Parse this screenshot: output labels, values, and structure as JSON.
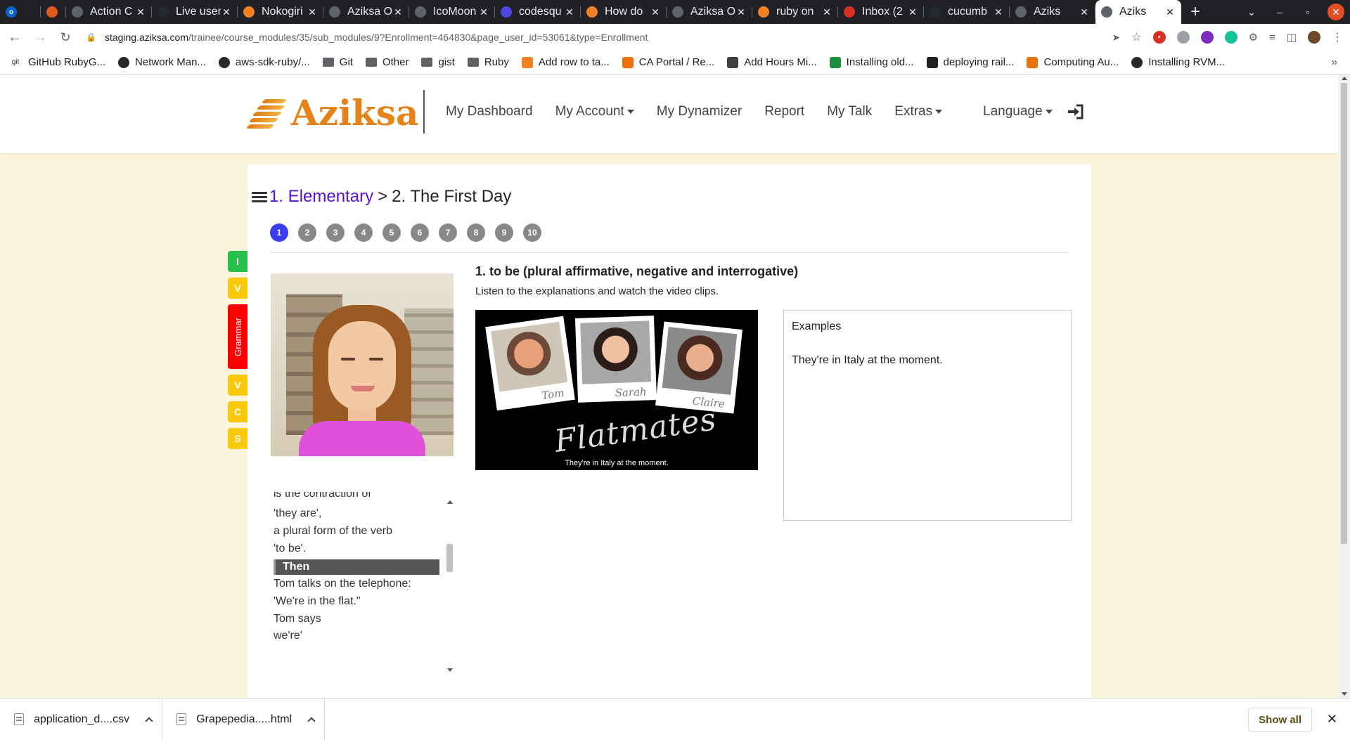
{
  "browser": {
    "tabs": [
      {
        "title": "",
        "favicon_color": "#0a64c8",
        "favicon_glyph": "o"
      },
      {
        "title": "",
        "favicon_color": "#e05a1c",
        "favicon_glyph": ""
      },
      {
        "title": "Action C",
        "favicon_color": "#5f6368",
        "favicon_glyph": ""
      },
      {
        "title": "Live user",
        "favicon_color": "#24292e",
        "favicon_glyph": ""
      },
      {
        "title": "Nokogiri",
        "favicon_color": "#f48024",
        "favicon_glyph": ""
      },
      {
        "title": "Aziksa O",
        "favicon_color": "#5f6368",
        "favicon_glyph": ""
      },
      {
        "title": "IcoMoon",
        "favicon_color": "#5f6368",
        "favicon_glyph": ""
      },
      {
        "title": "codesqu",
        "favicon_color": "#4f46e5",
        "favicon_glyph": ""
      },
      {
        "title": "How do",
        "favicon_color": "#f48024",
        "favicon_glyph": ""
      },
      {
        "title": "Aziksa O",
        "favicon_color": "#5f6368",
        "favicon_glyph": ""
      },
      {
        "title": "ruby on",
        "favicon_color": "#f48024",
        "favicon_glyph": ""
      },
      {
        "title": "Inbox (2",
        "favicon_color": "#d93025",
        "favicon_glyph": ""
      },
      {
        "title": "cucumb",
        "favicon_color": "#24292e",
        "favicon_glyph": ""
      },
      {
        "title": "Aziks",
        "favicon_color": "#5f6368",
        "favicon_glyph": ""
      },
      {
        "title": "Aziks",
        "favicon_color": "#5f6368",
        "favicon_glyph": ""
      }
    ],
    "url_host": "staging.aziksa.com",
    "url_path": "/trainee/course_modules/35/sub_modules/9?Enrollment=464830&page_user_id=53061&type=Enrollment",
    "bookmarks": [
      {
        "label": "GitHub RubyG...",
        "icon": "git-icon"
      },
      {
        "label": "Network Man...",
        "icon": "github-icon"
      },
      {
        "label": "aws-sdk-ruby/...",
        "icon": "github-icon"
      },
      {
        "label": "Git",
        "icon": "folder-icon"
      },
      {
        "label": "Other",
        "icon": "folder-icon"
      },
      {
        "label": "gist",
        "icon": "folder-icon"
      },
      {
        "label": "Ruby",
        "icon": "folder-icon"
      },
      {
        "label": "Add row to ta...",
        "icon": "stackoverflow-icon"
      },
      {
        "label": "CA Portal / Re...",
        "icon": "portal-icon"
      },
      {
        "label": "Add Hours Mi...",
        "icon": "calculator-icon"
      },
      {
        "label": "Installing old...",
        "icon": "bookmark-icon"
      },
      {
        "label": "deploying rail...",
        "icon": "v-icon"
      },
      {
        "label": "Computing Au...",
        "icon": "portal-icon"
      },
      {
        "label": "Installing RVM...",
        "icon": "github-icon"
      }
    ]
  },
  "header": {
    "logo_text": "Aziksa",
    "nav": [
      {
        "label": "My Dashboard",
        "dropdown": false
      },
      {
        "label": "My Account",
        "dropdown": true
      },
      {
        "label": "My Dynamizer",
        "dropdown": false
      },
      {
        "label": "Report",
        "dropdown": false
      },
      {
        "label": "My Talk",
        "dropdown": false
      },
      {
        "label": "Extras",
        "dropdown": true
      }
    ],
    "language_label": "Language"
  },
  "course": {
    "breadcrumb_link": "1. Elementary",
    "breadcrumb_sep": ">",
    "breadcrumb_current": "2. The First Day",
    "pages": [
      "1",
      "2",
      "3",
      "4",
      "5",
      "6",
      "7",
      "8",
      "9",
      "10"
    ],
    "active_page": 1,
    "side_tabs": [
      {
        "label": "I",
        "color": "#26c04a"
      },
      {
        "label": "V",
        "color": "#f7c90a"
      },
      {
        "label": "Grammar",
        "color": "#ff0000"
      },
      {
        "label": "V",
        "color": "#f7c90a"
      },
      {
        "label": "C",
        "color": "#f7c90a"
      },
      {
        "label": "S",
        "color": "#f7c90a"
      }
    ]
  },
  "transcript": {
    "lines": [
      {
        "text": "is the contraction of",
        "highlight": false
      },
      {
        "text": "'they are',",
        "highlight": false
      },
      {
        "text": "a plural form of the verb",
        "highlight": false
      },
      {
        "text": "'to be'.",
        "highlight": false
      },
      {
        "text": "Then",
        "highlight": true
      },
      {
        "text": "Tom talks on the telephone:",
        "highlight": false
      },
      {
        "text": "'We're in the flat.\"",
        "highlight": false
      },
      {
        "text": "Tom says",
        "highlight": false
      },
      {
        "text": "we're'",
        "highlight": false
      }
    ]
  },
  "lesson": {
    "title": "1. to be (plural affirmative, negative and interrogative)",
    "subtitle": "Listen to the explanations and watch the video clips.",
    "video": {
      "names": [
        "Tom",
        "Sarah",
        "Claire"
      ],
      "show_title": "Flatmates",
      "caption": "They're in Italy at the moment."
    },
    "examples": {
      "heading": "Examples",
      "text": "They're in Italy at the moment."
    }
  },
  "downloads": {
    "items": [
      "application_d....csv",
      "Grapepedia.....html"
    ],
    "show_all_label": "Show all"
  }
}
